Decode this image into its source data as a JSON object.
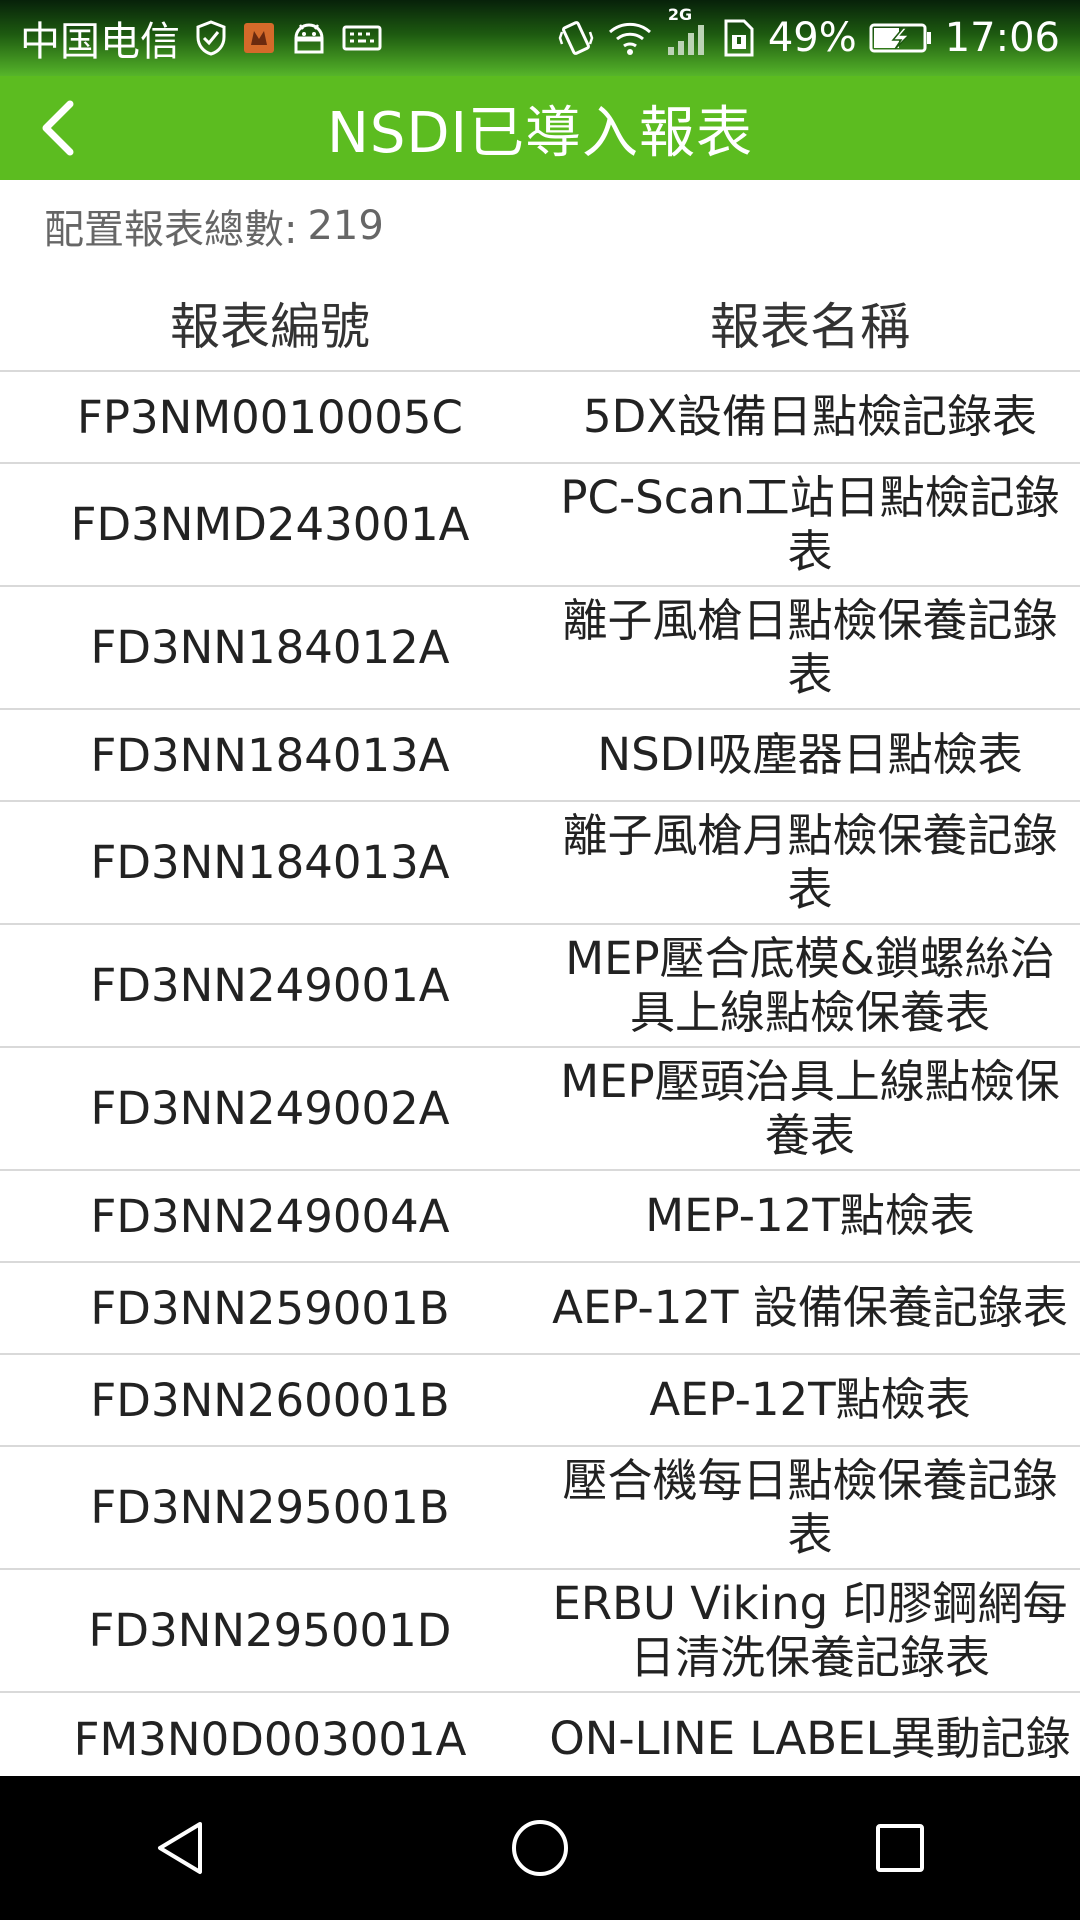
{
  "status_bar": {
    "carrier": "中国电信",
    "network_type": "2G",
    "battery_percent": "49%",
    "time": "17:06",
    "icons": [
      "shield-check-icon",
      "notification-app-icon",
      "android-icon",
      "keyboard-icon",
      "vibrate-icon",
      "wifi-icon",
      "signal-icon",
      "sim-icon",
      "battery-charging-icon"
    ]
  },
  "header": {
    "back_icon": "chevron-left-icon",
    "title": "NSDI已導入報表",
    "color": "#5cbc20"
  },
  "summary": {
    "label": "配置報表總數:",
    "count": "219"
  },
  "table": {
    "headers": {
      "code": "報表編號",
      "name": "報表名稱"
    },
    "rows": [
      {
        "code": "FP3NM0010005C",
        "name": "5DX設備日點檢記錄表"
      },
      {
        "code": "FD3NMD243001A",
        "name": "PC-Scan工站日點檢記錄\n表"
      },
      {
        "code": "FD3NN184012A",
        "name": "離子風槍日點檢保養記錄\n表"
      },
      {
        "code": "FD3NN184013A",
        "name": "NSDI吸塵器日點檢表"
      },
      {
        "code": "FD3NN184013A",
        "name": "離子風槍月點檢保養記錄\n表"
      },
      {
        "code": "FD3NN249001A",
        "name": "MEP壓合底模&鎖螺絲治\n具上線點檢保養表"
      },
      {
        "code": "FD3NN249002A",
        "name": "MEP壓頭治具上線點檢保\n養表"
      },
      {
        "code": "FD3NN249004A",
        "name": "MEP-12T點檢表"
      },
      {
        "code": "FD3NN259001B",
        "name": "AEP-12T 設備保養記錄表"
      },
      {
        "code": "FD3NN260001B",
        "name": "AEP-12T點檢表"
      },
      {
        "code": "FD3NN295001B",
        "name": "壓合機每日點檢保養記錄\n表"
      },
      {
        "code": "FD3NN295001D",
        "name": "ERBU Viking 印膠鋼網每\n日清洗保養記錄表"
      },
      {
        "code": "FM3N0D003001A",
        "name": "ON-LINE LABEL異動記錄"
      }
    ]
  },
  "nav_bar": {
    "icons": [
      "back-triangle-icon",
      "home-circle-icon",
      "recents-square-icon"
    ]
  }
}
